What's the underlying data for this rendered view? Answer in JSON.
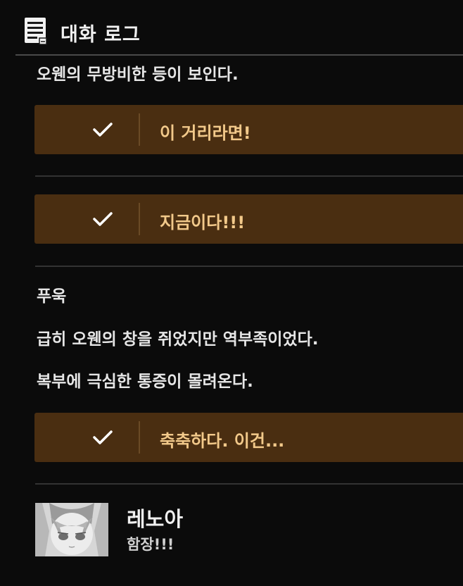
{
  "header": {
    "icon": "log-document-icon",
    "title": "대화 로그"
  },
  "log": {
    "line1": "오웬의 무방비한 등이 보인다.",
    "choice1": "이 거리라면!",
    "choice2": "지금이다!!!",
    "line2": "푸욱",
    "line3": "급히 오웬의 창을 쥐었지만 역부족이었다.",
    "line4": "복부에 극심한 통증이 몰려온다.",
    "choice3": "축축하다. 이건...",
    "speaker": {
      "name": "레노아",
      "line": "함장!!!",
      "portrait": "character-portrait"
    }
  },
  "colors": {
    "background": "#0b0b0b",
    "choice_bg": "#4a2e11",
    "choice_text": "#f2c98a",
    "check": "#ffffff"
  }
}
